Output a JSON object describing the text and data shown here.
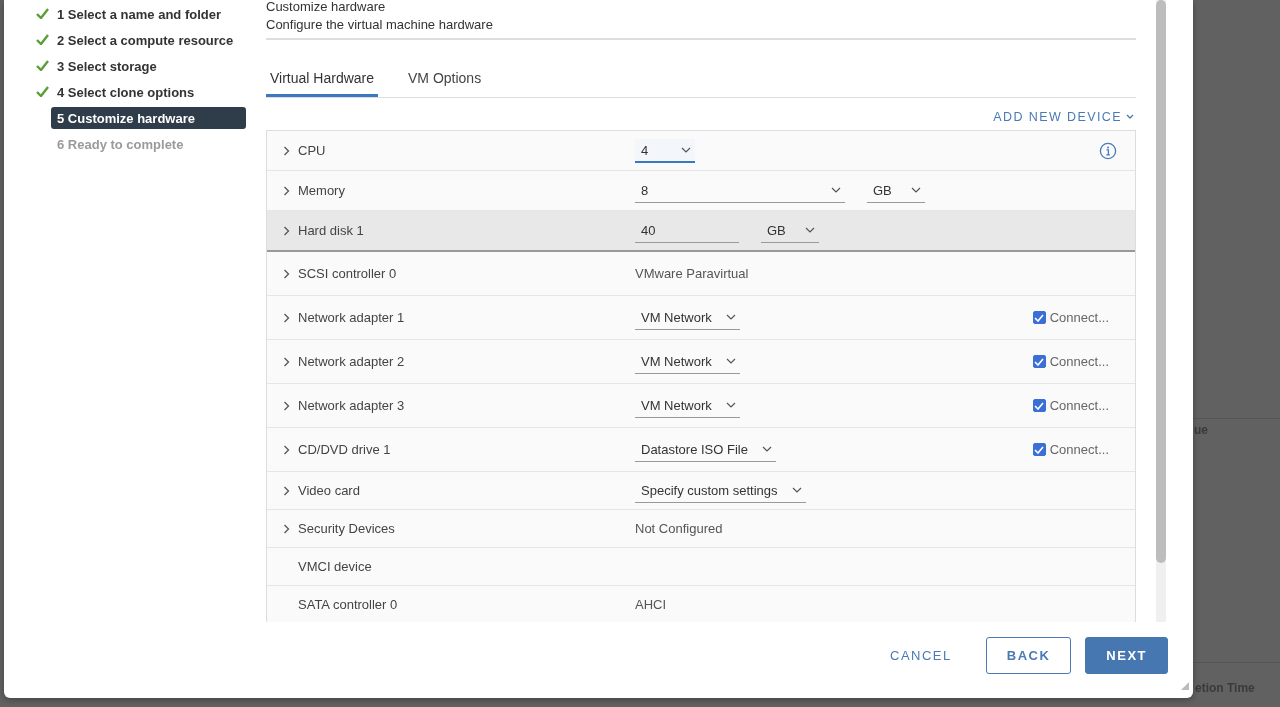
{
  "wizard": {
    "steps": [
      {
        "label": "1 Select a name and folder",
        "completed": true,
        "selected": false
      },
      {
        "label": "2 Select a compute resource",
        "completed": true,
        "selected": false
      },
      {
        "label": "3 Select storage",
        "completed": true,
        "selected": false
      },
      {
        "label": "4 Select clone options",
        "completed": true,
        "selected": false
      },
      {
        "label": "5 Customize hardware",
        "completed": false,
        "selected": true
      },
      {
        "label": "6 Ready to complete",
        "completed": false,
        "selected": false
      }
    ]
  },
  "page": {
    "title": "Customize hardware",
    "subtitle": "Configure the virtual machine hardware"
  },
  "tabs": [
    {
      "label": "Virtual Hardware",
      "selected": true
    },
    {
      "label": "VM Options",
      "selected": false
    }
  ],
  "add_device": {
    "label": "ADD NEW DEVICE"
  },
  "devices": [
    {
      "name": "CPU",
      "expandable": true,
      "highlighted": false,
      "kind": "select",
      "value": "4",
      "focused": true,
      "info": true
    },
    {
      "name": "Memory",
      "expandable": true,
      "highlighted": false,
      "kind": "select",
      "value": "8",
      "unit": "GB"
    },
    {
      "name": "Hard disk 1",
      "expandable": true,
      "highlighted": true,
      "kind": "input",
      "value": "40",
      "unit": "GB"
    },
    {
      "name": "SCSI controller 0",
      "expandable": true,
      "highlighted": false,
      "kind": "text",
      "value": "VMware Paravirtual"
    },
    {
      "name": "Network adapter 1",
      "expandable": true,
      "highlighted": false,
      "kind": "select",
      "value": "VM Network",
      "connect": {
        "label": "Connect...",
        "checked": true
      }
    },
    {
      "name": "Network adapter 2",
      "expandable": true,
      "highlighted": false,
      "kind": "select",
      "value": "VM Network",
      "connect": {
        "label": "Connect...",
        "checked": true
      }
    },
    {
      "name": "Network adapter 3",
      "expandable": true,
      "highlighted": false,
      "kind": "select",
      "value": "VM Network",
      "connect": {
        "label": "Connect...",
        "checked": true
      }
    },
    {
      "name": "CD/DVD drive 1",
      "expandable": true,
      "highlighted": false,
      "kind": "select",
      "value": "Datastore ISO File",
      "connect": {
        "label": "Connect...",
        "checked": true
      }
    },
    {
      "name": "Video card",
      "expandable": true,
      "highlighted": false,
      "kind": "select",
      "value": "Specify custom settings"
    },
    {
      "name": "Security Devices",
      "expandable": true,
      "highlighted": false,
      "kind": "text",
      "value": "Not Configured"
    },
    {
      "name": "VMCI device",
      "expandable": false,
      "highlighted": false,
      "kind": "none"
    },
    {
      "name": "SATA controller 0",
      "expandable": false,
      "highlighted": false,
      "kind": "text",
      "value": "AHCI"
    }
  ],
  "buttons": [
    {
      "label": "CANCEL",
      "kind": "flat"
    },
    {
      "label": "BACK",
      "kind": "outline"
    },
    {
      "label": "NEXT",
      "kind": "primary"
    }
  ],
  "background": {
    "fragments": [
      "ue",
      "etion Time"
    ]
  }
}
